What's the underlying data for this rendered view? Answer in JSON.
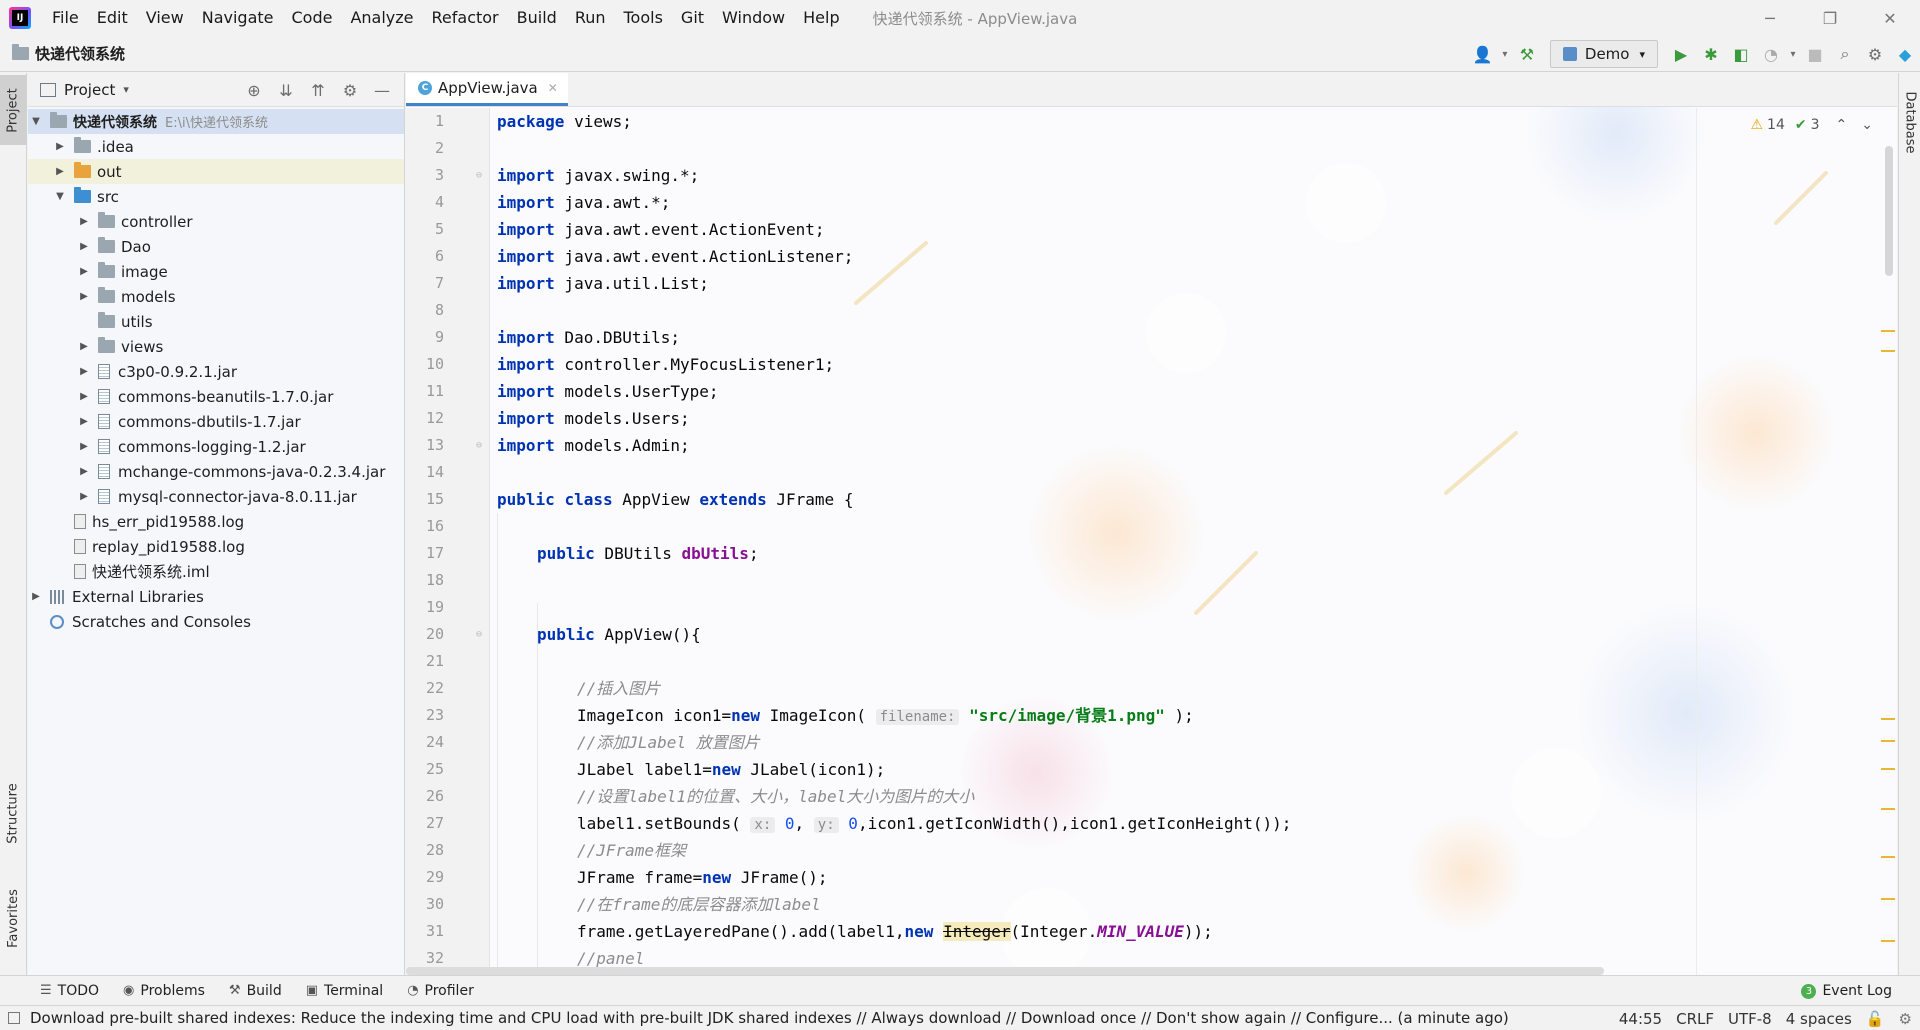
{
  "window": {
    "title": "快递代领系统 - AppView.java",
    "minimize": "─",
    "maximize": "❐",
    "close": "✕"
  },
  "menu": [
    "File",
    "Edit",
    "View",
    "Navigate",
    "Code",
    "Analyze",
    "Refactor",
    "Build",
    "Run",
    "Tools",
    "Git",
    "Window",
    "Help"
  ],
  "navbar": {
    "project_name": "快递代领系统",
    "run_config": "Demo"
  },
  "left_stripe": {
    "project_tab": "Project",
    "structure_tab": "Structure",
    "favorites_tab": "Favorites"
  },
  "right_stripe": {
    "database_tab": "Database"
  },
  "project_panel": {
    "header": "Project",
    "tree": [
      {
        "label": "快递代领系统",
        "hint": "E:\\i\\快递代领系统",
        "kind": "root"
      },
      {
        "label": ".idea",
        "kind": "folder"
      },
      {
        "label": "out",
        "kind": "folder-orange"
      },
      {
        "label": "src",
        "kind": "folder-blue"
      },
      {
        "label": "controller",
        "kind": "package"
      },
      {
        "label": "Dao",
        "kind": "package"
      },
      {
        "label": "image",
        "kind": "package"
      },
      {
        "label": "models",
        "kind": "package"
      },
      {
        "label": "utils",
        "kind": "package"
      },
      {
        "label": "views",
        "kind": "package"
      },
      {
        "label": "c3p0-0.9.2.1.jar",
        "kind": "jar"
      },
      {
        "label": "commons-beanutils-1.7.0.jar",
        "kind": "jar"
      },
      {
        "label": "commons-dbutils-1.7.jar",
        "kind": "jar"
      },
      {
        "label": "commons-logging-1.2.jar",
        "kind": "jar"
      },
      {
        "label": "mchange-commons-java-0.2.3.4.jar",
        "kind": "jar"
      },
      {
        "label": "mysql-connector-java-8.0.11.jar",
        "kind": "jar"
      },
      {
        "label": "hs_err_pid19588.log",
        "kind": "file"
      },
      {
        "label": "replay_pid19588.log",
        "kind": "file"
      },
      {
        "label": "快递代领系统.iml",
        "kind": "file"
      },
      {
        "label": "External Libraries",
        "kind": "libs"
      },
      {
        "label": "Scratches and Consoles",
        "kind": "scratch"
      }
    ]
  },
  "editor": {
    "tab": "AppView.java",
    "tab_icon": "C",
    "warnings": "14",
    "ok_count": "3",
    "line_numbers": [
      "1",
      "2",
      "3",
      "4",
      "5",
      "6",
      "7",
      "8",
      "9",
      "10",
      "11",
      "12",
      "13",
      "14",
      "15",
      "16",
      "17",
      "18",
      "19",
      "20",
      "21",
      "22",
      "23",
      "24",
      "25",
      "26",
      "27",
      "28",
      "29",
      "30",
      "31",
      "32"
    ],
    "code": {
      "l1_kw": "package",
      "l1_rest": " views;",
      "import_kw": "import",
      "l3": " javax.swing.*;",
      "l4": " java.awt.*;",
      "l5": " java.awt.event.ActionEvent;",
      "l6": " java.awt.event.ActionListener;",
      "l7": " java.util.List;",
      "l9": " Dao.DBUtils;",
      "l10": " controller.MyFocusListener1;",
      "l11": " models.UserType;",
      "l12": " models.Users;",
      "l13": " models.Admin;",
      "l15_public": "public",
      "l15_class": "class",
      "l15_name": " AppView ",
      "l15_extends": "extends",
      "l15_rest": " JFrame {",
      "l17_type": " DBUtils ",
      "l17_field": "dbUtils",
      "l17_end": ";",
      "l20_rest": " AppView(){",
      "l22": "//插入图片",
      "l23_a": "ImageIcon icon1=",
      "l23_new": "new",
      "l23_b": " ImageIcon( ",
      "l23_hint": "filename:",
      "l23_str": "\"src/image/背景1.png\"",
      "l23_c": " );",
      "l24": "//添加JLabel 放置图片",
      "l25_a": "JLabel label1=",
      "l25_b": " JLabel(icon1);",
      "l26": "//设置label1的位置、大小，label大小为图片的大小",
      "l27_a": "label1.setBounds( ",
      "l27_hx": "x:",
      "l27_x": "0",
      "l27_sep": ", ",
      "l27_hy": "y:",
      "l27_y": "0",
      "l27_b": ",icon1.getIconWidth(),icon1.getIconHeight());",
      "l28": "//JFrame框架",
      "l29_a": "JFrame frame=",
      "l29_b": " JFrame();",
      "l30": "//在frame的底层容器添加label",
      "l31_a": "frame.getLayeredPane().add(label1,",
      "l31_dep": "Integer",
      "l31_b": "(Integer.",
      "l31_stat": "MIN_VALUE",
      "l31_c": "));",
      "l32": "//panel"
    }
  },
  "bottom_tools": {
    "todo": "TODO",
    "problems": "Problems",
    "build": "Build",
    "terminal": "Terminal",
    "profiler": "Profiler",
    "event_log": "Event Log",
    "event_count": "3"
  },
  "status": {
    "message": "Download pre-built shared indexes: Reduce the indexing time and CPU load with pre-built JDK shared indexes // Always download // Download once // Don't show again // Configure... (a minute ago)",
    "position": "44:55",
    "line_sep": "CRLF",
    "encoding": "UTF-8",
    "indent": "4 spaces"
  }
}
